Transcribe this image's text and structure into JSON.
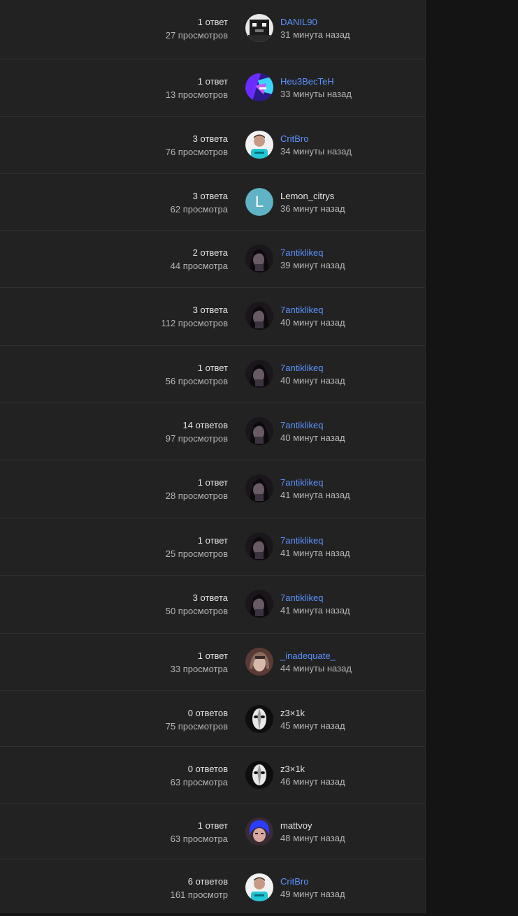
{
  "threads": [
    {
      "replies": "1 ответ",
      "views": "27 просмотров",
      "author": "DANIL90",
      "author_is_link": true,
      "time": "31 минута назад",
      "avatar": "pixel-robot"
    },
    {
      "replies": "1 ответ",
      "views": "13 просмотров",
      "author": "Heu3BecTeH",
      "author_is_link": true,
      "time": "33 минуты назад",
      "avatar": "purple-abstract"
    },
    {
      "replies": "3 ответа",
      "views": "76 просмотров",
      "author": "CritBro",
      "author_is_link": true,
      "time": "34 минуты назад",
      "avatar": "person-cyan"
    },
    {
      "replies": "3 ответа",
      "views": "62 просмотра",
      "author": "Lemon_citrys",
      "author_is_link": false,
      "time": "36 минут назад",
      "avatar": "letter",
      "avatar_letter": "L"
    },
    {
      "replies": "2 ответа",
      "views": "44 просмотра",
      "author": "7antiklikeq",
      "author_is_link": true,
      "time": "39 минут назад",
      "avatar": "dark-portrait"
    },
    {
      "replies": "3 ответа",
      "views": "112 просмотров",
      "author": "7antiklikeq",
      "author_is_link": true,
      "time": "40 минут назад",
      "avatar": "dark-portrait"
    },
    {
      "replies": "1 ответ",
      "views": "56 просмотров",
      "author": "7antiklikeq",
      "author_is_link": true,
      "time": "40 минут назад",
      "avatar": "dark-portrait"
    },
    {
      "replies": "14 ответов",
      "views": "97 просмотров",
      "author": "7antiklikeq",
      "author_is_link": true,
      "time": "40 минут назад",
      "avatar": "dark-portrait"
    },
    {
      "replies": "1 ответ",
      "views": "28 просмотров",
      "author": "7antiklikeq",
      "author_is_link": true,
      "time": "41 минута назад",
      "avatar": "dark-portrait"
    },
    {
      "replies": "1 ответ",
      "views": "25 просмотров",
      "author": "7antiklikeq",
      "author_is_link": true,
      "time": "41 минута назад",
      "avatar": "dark-portrait"
    },
    {
      "replies": "3 ответа",
      "views": "50 просмотров",
      "author": "7antiklikeq",
      "author_is_link": true,
      "time": "41 минута назад",
      "avatar": "dark-portrait"
    },
    {
      "replies": "1 ответ",
      "views": "33 просмотра",
      "author": "_inadequate_",
      "author_is_link": true,
      "time": "44 минуты назад",
      "avatar": "sepia-portrait"
    },
    {
      "replies": "0 ответов",
      "views": "75 просмотров",
      "author": "z3×1k",
      "author_is_link": false,
      "time": "45 минут назад",
      "avatar": "white-mask"
    },
    {
      "replies": "0 ответов",
      "views": "63 просмотра",
      "author": "z3×1k",
      "author_is_link": false,
      "time": "46 минут назад",
      "avatar": "white-mask"
    },
    {
      "replies": "1 ответ",
      "views": "63 просмотра",
      "author": "mattvoy",
      "author_is_link": false,
      "time": "48 минут назад",
      "avatar": "blue-hair"
    },
    {
      "replies": "6 ответов",
      "views": "161 просмотр",
      "author": "CritBro",
      "author_is_link": true,
      "time": "49 минут назад",
      "avatar": "person-cyan"
    }
  ],
  "colors": {
    "link": "#5c92ff",
    "text": "#e4e4e4",
    "muted": "#b6b6b6",
    "panel_bg": "#222222",
    "page_bg": "#141414",
    "letter_avatar_bg": "#5fb3c4"
  }
}
